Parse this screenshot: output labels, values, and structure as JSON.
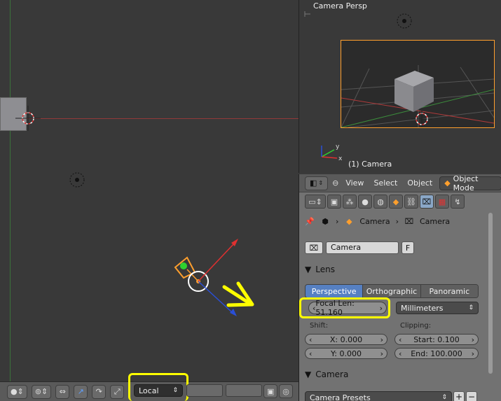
{
  "camera_view": {
    "title": "Camera Persp",
    "object_label": "(1) Camera",
    "axis_y": "y",
    "axis_x": "x"
  },
  "header": {
    "menus": [
      "View",
      "Select",
      "Object"
    ],
    "mode_label": "Object Mode"
  },
  "breadcrumb": {
    "object": "Camera",
    "data": "Camera"
  },
  "datablock": {
    "name": "Camera",
    "fake_user": "F"
  },
  "lens": {
    "panel_title": "Lens",
    "types": [
      "Perspective",
      "Orthographic",
      "Panoramic"
    ],
    "active_type": "Perspective",
    "focal_length": "Focal Len: 51.160",
    "unit": "Millimeters",
    "shift_label": "Shift:",
    "shift_x": "X: 0.000",
    "shift_y": "Y: 0.000",
    "clipping_label": "Clipping:",
    "clip_start": "Start: 0.100",
    "clip_end": "End: 100.000"
  },
  "camera_panel": {
    "panel_title": "Camera",
    "presets": "Camera Presets",
    "add": "+",
    "remove": "−"
  },
  "bottom_bar": {
    "orientation": "Local"
  },
  "colors": {
    "active_blue": "#5680c2",
    "highlight": "#ffff00",
    "selection_orange": "#ff9f2d"
  }
}
